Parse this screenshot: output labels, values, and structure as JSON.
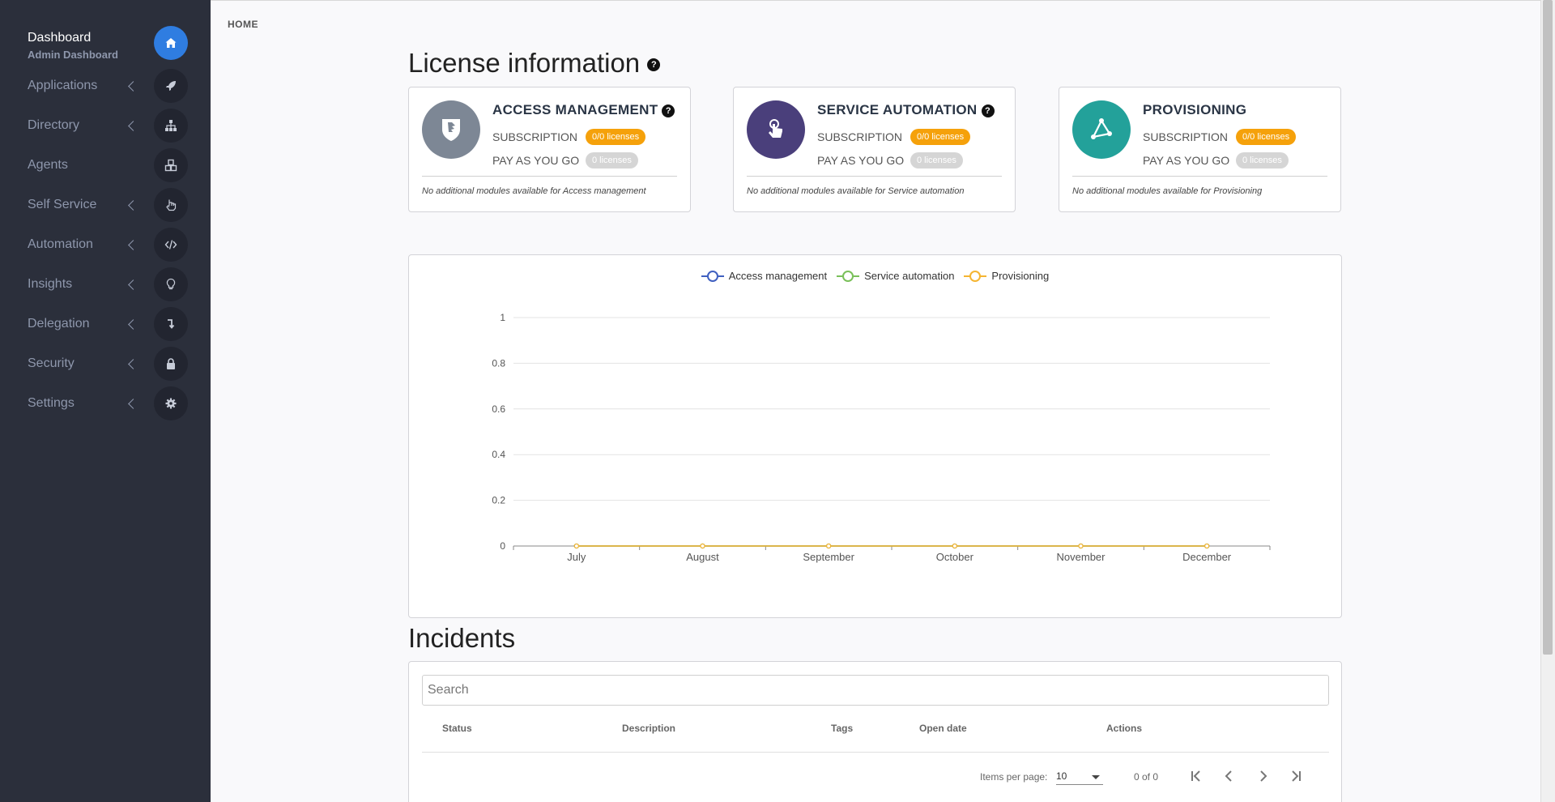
{
  "sidebar": {
    "dashboard": {
      "label": "Dashboard",
      "sub": "Admin Dashboard"
    },
    "items": [
      {
        "label": "Applications",
        "icon": "rocket-icon"
      },
      {
        "label": "Directory",
        "icon": "sitemap-icon"
      },
      {
        "label": "Agents",
        "icon": "cubes-icon"
      },
      {
        "label": "Self Service",
        "icon": "hand-pointer-icon"
      },
      {
        "label": "Automation",
        "icon": "code-icon"
      },
      {
        "label": "Insights",
        "icon": "lightbulb-icon"
      },
      {
        "label": "Delegation",
        "icon": "level-down-icon"
      },
      {
        "label": "Security",
        "icon": "lock-icon"
      },
      {
        "label": "Settings",
        "icon": "gear-icon"
      }
    ]
  },
  "breadcrumb": "HOME",
  "license": {
    "title": "License information",
    "help": "?",
    "cards": [
      {
        "title": "ACCESS MANAGEMENT",
        "sub_label": "SUBSCRIPTION",
        "sub_value": "0/0 licenses",
        "payg_label": "PAY AS YOU GO",
        "payg_value": "0 licenses",
        "note": "No additional modules available for Access management",
        "color": "#7d8795",
        "help": "?"
      },
      {
        "title": "SERVICE AUTOMATION",
        "sub_label": "SUBSCRIPTION",
        "sub_value": "0/0 licenses",
        "payg_label": "PAY AS YOU GO",
        "payg_value": "0 licenses",
        "note": "No additional modules available for Service automation",
        "color": "#4a3f7b",
        "help": "?"
      },
      {
        "title": "PROVISIONING",
        "sub_label": "SUBSCRIPTION",
        "sub_value": "0/0 licenses",
        "payg_label": "PAY AS YOU GO",
        "payg_value": "0 licenses",
        "note": "No additional modules available for Provisioning",
        "color": "#23a19a"
      }
    ]
  },
  "chart_data": {
    "type": "line",
    "categories": [
      "July",
      "August",
      "September",
      "October",
      "November",
      "December"
    ],
    "series": [
      {
        "name": "Access management",
        "values": [
          0,
          0,
          0,
          0,
          0,
          0
        ],
        "color": "#4060c0"
      },
      {
        "name": "Service automation",
        "values": [
          0,
          0,
          0,
          0,
          0,
          0
        ],
        "color": "#7ac05a"
      },
      {
        "name": "Provisioning",
        "values": [
          0,
          0,
          0,
          0,
          0,
          0
        ],
        "color": "#f5b532"
      }
    ],
    "ylim": [
      0,
      1
    ],
    "yticks": [
      "0",
      "0.2",
      "0.4",
      "0.6",
      "0.8",
      "1"
    ],
    "legend": "top-center",
    "grid": true
  },
  "incidents": {
    "title": "Incidents",
    "search_placeholder": "Search",
    "columns": [
      "Status",
      "Description",
      "Tags",
      "Open date",
      "Actions"
    ],
    "items_per_page_label": "Items per page:",
    "items_per_page": "10",
    "range": "0 of 0"
  }
}
